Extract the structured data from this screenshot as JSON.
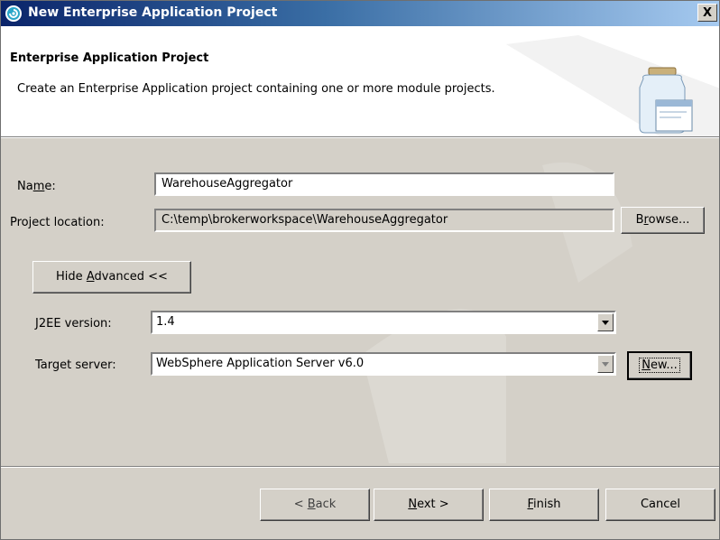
{
  "window": {
    "title": "New Enterprise Application Project",
    "close_glyph": "X"
  },
  "banner": {
    "heading": "Enterprise Application Project",
    "description": "Create an Enterprise Application project containing one or more module projects.",
    "icon": "jar-window-icon"
  },
  "form": {
    "name": {
      "label_pre": "Na",
      "label_mn": "m",
      "label_post": "e:",
      "value": "WarehouseAggregator"
    },
    "location": {
      "label": "Project location:",
      "value": "C:\\temp\\brokerworkspace\\WarehouseAggregator"
    },
    "browse": {
      "pre": "B",
      "mn": "r",
      "post": "owse..."
    },
    "advanced": {
      "pre": "Hide ",
      "mn": "A",
      "post": "dvanced <<"
    },
    "j2ee": {
      "label": "J2EE version:",
      "value": "1.4"
    },
    "server": {
      "label": "Target server:",
      "value": "WebSphere Application Server v6.0"
    },
    "new_button": {
      "pre": "",
      "mn": "N",
      "post": "ew..."
    }
  },
  "footer": {
    "back": {
      "pre": "< ",
      "mn": "B",
      "post": "ack"
    },
    "next": {
      "pre": "",
      "mn": "N",
      "post": "ext >"
    },
    "finish": {
      "pre": "",
      "mn": "F",
      "post": "inish"
    },
    "cancel": {
      "label": "Cancel"
    }
  },
  "colors": {
    "title_start": "#0a246a",
    "title_end": "#a6caf0",
    "face": "#d4d0c8"
  }
}
